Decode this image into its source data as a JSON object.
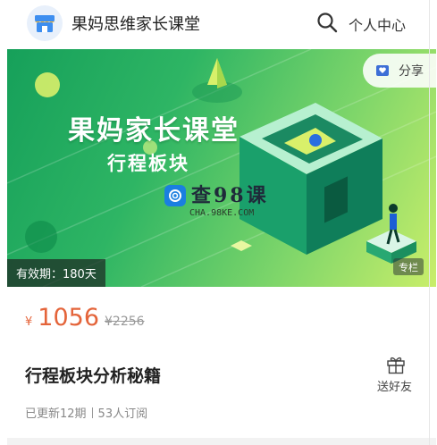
{
  "header": {
    "shop_name": "果妈思维家长课堂",
    "personal_center": "个人中心",
    "logo_icon": "shop-logo-icon",
    "search_icon": "search-icon"
  },
  "banner": {
    "title": "果妈家长课堂",
    "subtitle": "行程板块",
    "watermark_text": "查98课",
    "watermark_domain": "CHA.98KE.COM",
    "share_label": "分享",
    "validity": "有效期：180天",
    "column_badge": "专栏"
  },
  "product": {
    "currency": "¥",
    "price": "1056",
    "original_price": "¥2256",
    "title": "行程板块分析秘籍",
    "gift_label": "送好友",
    "updates": "已更新12期",
    "subscribers": "53人订阅"
  },
  "colors": {
    "price_accent": "#e4643a",
    "banner_green": "#2eb564",
    "banner_lime": "#c9ee6a"
  }
}
